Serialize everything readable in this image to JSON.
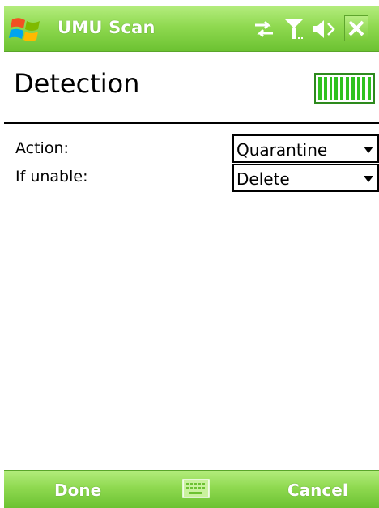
{
  "title_bar": {
    "app_title": "UMU Scan",
    "start_icon": "windows-flag-icon",
    "status_icons": [
      "data-connection-icon",
      "signal-strength-icon",
      "speaker-muted-icon"
    ],
    "close_icon": "close-icon"
  },
  "header": {
    "page_title": "Detection",
    "battery_icon": "battery-full-icon",
    "battery_level": 1.0
  },
  "form": {
    "action": {
      "label": "Action:",
      "value": "Quarantine"
    },
    "if_unable": {
      "label": "If unable:",
      "value": "Delete"
    }
  },
  "softkeys": {
    "left": "Done",
    "center_icon": "keyboard-icon",
    "right": "Cancel"
  },
  "colors": {
    "bar_green": "#8fd950",
    "battery_green": "#2fc21f"
  }
}
